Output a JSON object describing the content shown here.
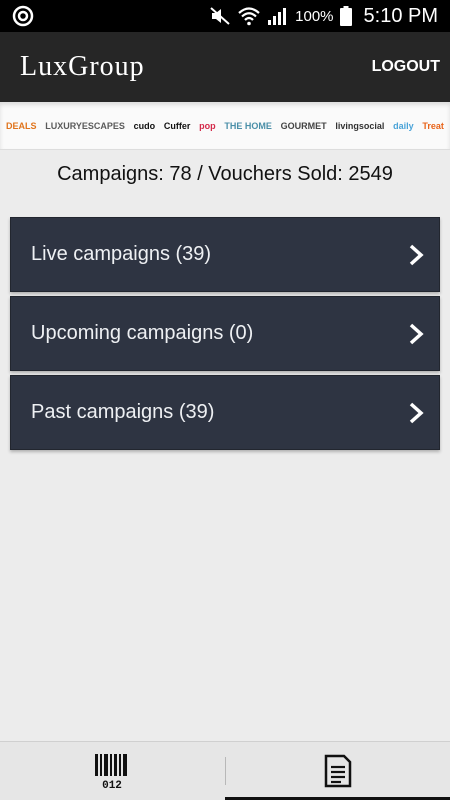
{
  "status_bar": {
    "battery_percent": "100%",
    "time": "5:10 PM"
  },
  "app_bar": {
    "logo_part1": "Lux",
    "logo_x": "",
    "logo_part2": "Group",
    "logout_label": "LOGOUT"
  },
  "brands": [
    {
      "label": "DEALS",
      "color": "#e0741c"
    },
    {
      "label": "LUXURYESCAPES",
      "color": "#5b5b5b"
    },
    {
      "label": "cudo",
      "color": "#111111"
    },
    {
      "label": "Cuffer",
      "color": "#111111"
    },
    {
      "label": "pop",
      "color": "#d42a4a"
    },
    {
      "label": "THE HOME",
      "color": "#4a8fa8"
    },
    {
      "label": "GOURMET",
      "color": "#444444"
    },
    {
      "label": "livingsocial",
      "color": "#333333"
    },
    {
      "label": "daily",
      "color": "#4aa3d8"
    },
    {
      "label": "Treat",
      "color": "#e8641a"
    }
  ],
  "summary": {
    "text": "Campaigns: 78 / Vouchers Sold: 2549"
  },
  "campaign_rows": [
    {
      "label": "Live campaigns (39)"
    },
    {
      "label": "Upcoming campaigns (0)"
    },
    {
      "label": "Past campaigns (39)"
    }
  ],
  "bottom_tabs": {
    "barcode_text": "012",
    "icons": [
      "barcode-icon",
      "document-list-icon"
    ]
  },
  "colors": {
    "app_bar": "#262626",
    "row_bg": "#2e3442",
    "page_bg": "#ececec"
  }
}
